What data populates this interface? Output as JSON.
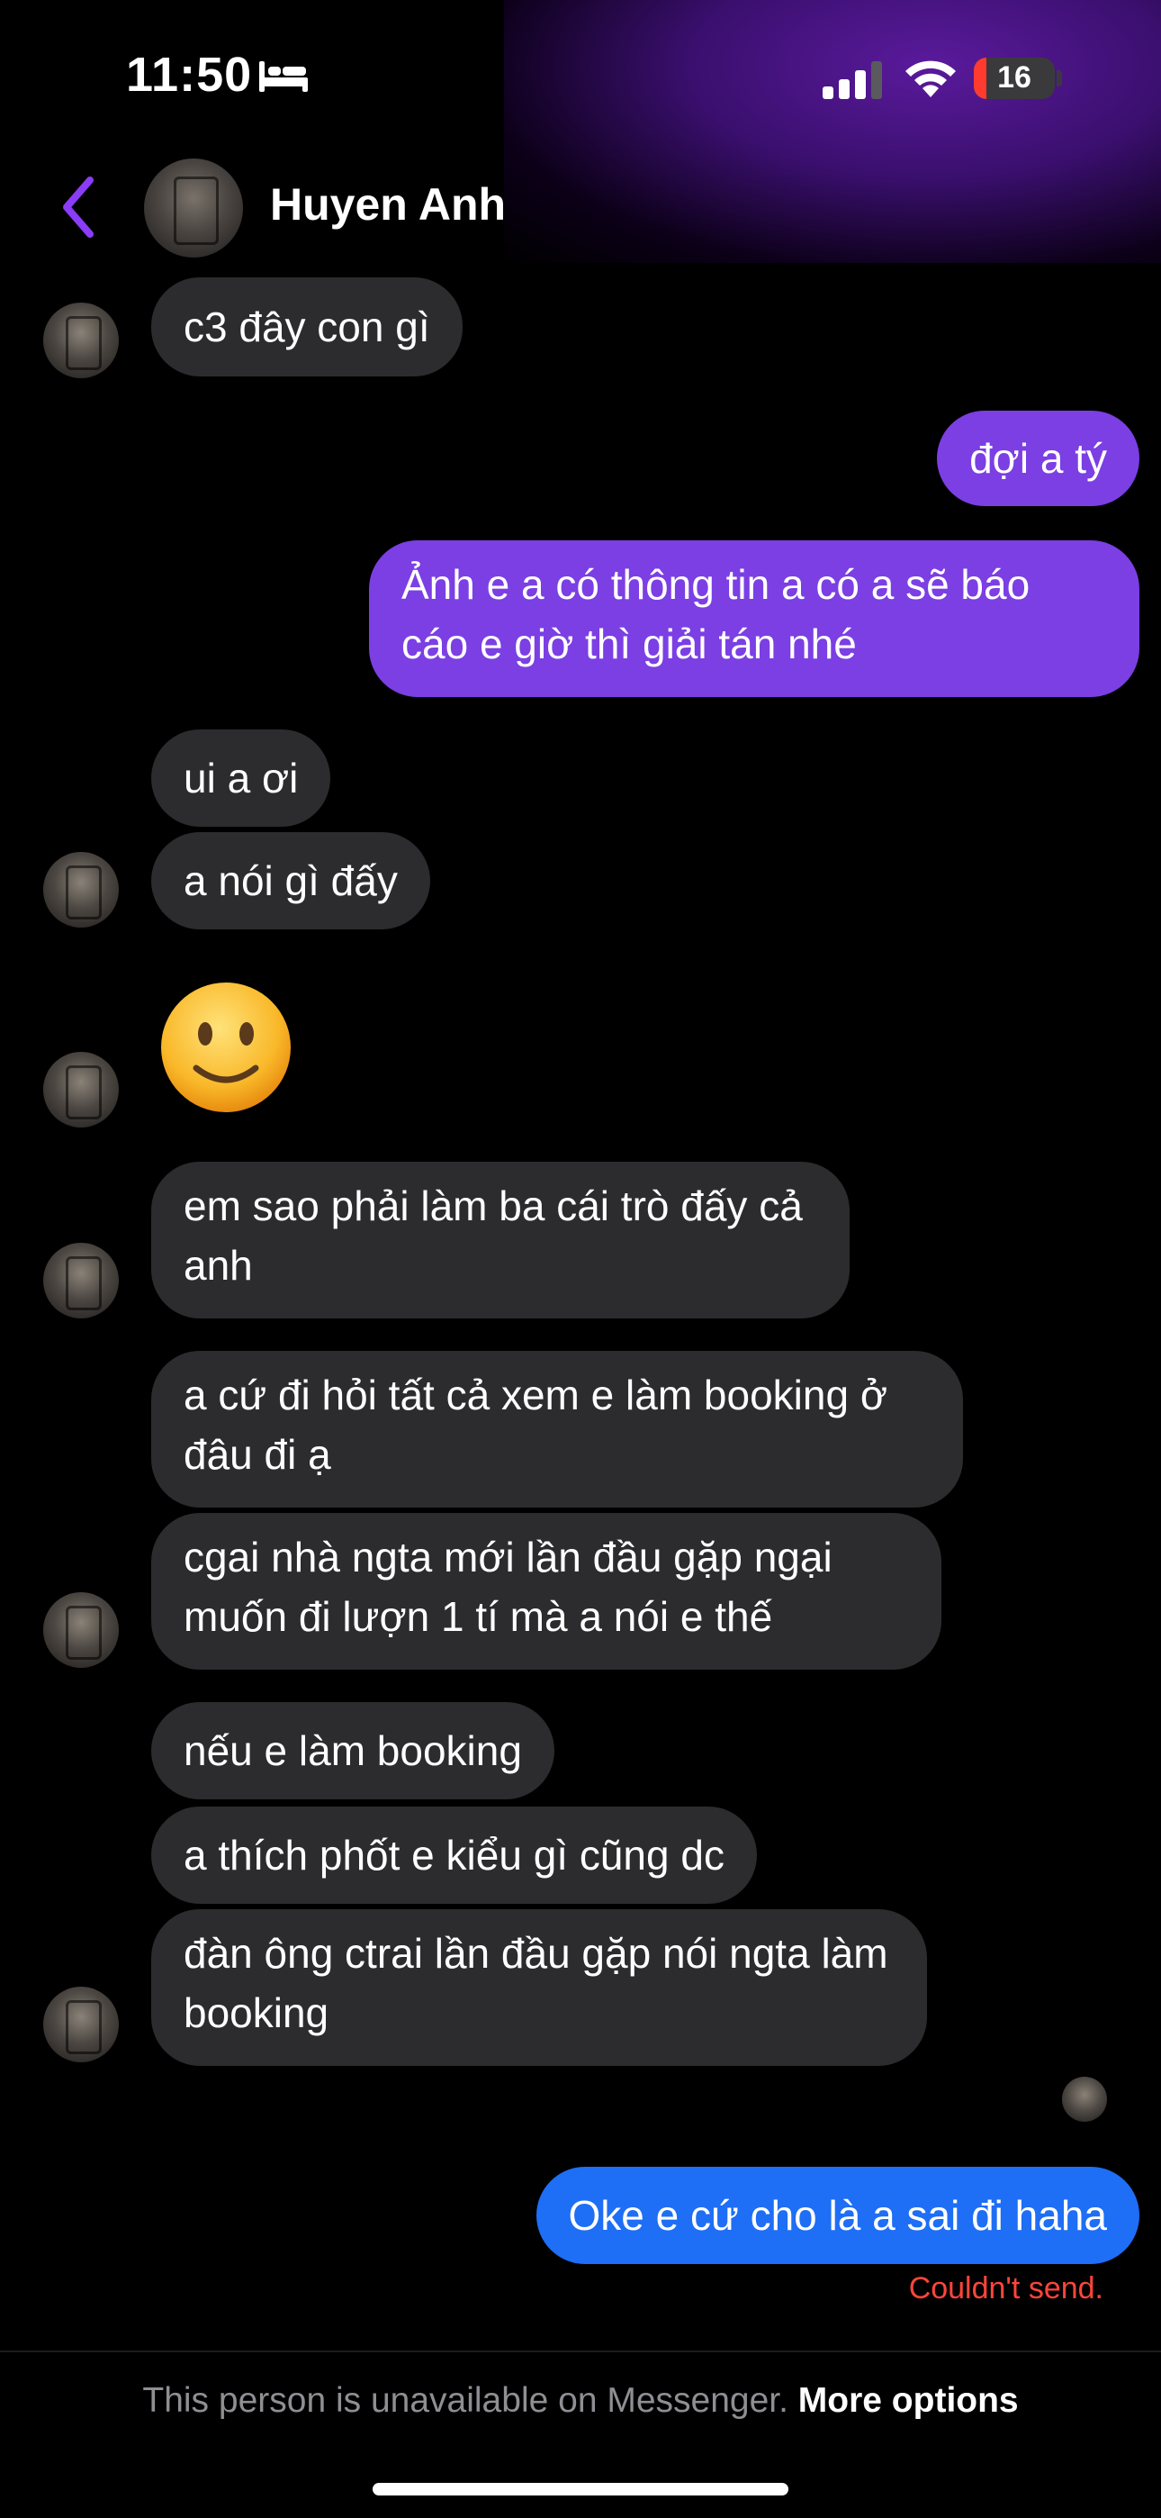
{
  "status_bar": {
    "time": "11:50",
    "battery_level": "16",
    "battery_color": "#ff3b30",
    "icons": [
      "bed-icon",
      "signal-icon",
      "wifi-icon",
      "battery-icon"
    ]
  },
  "header": {
    "contact_name": "Huyen Anh",
    "accent_color": "#8b3cf6"
  },
  "messages": [
    {
      "direction": "in",
      "text": "c3 đây con gì"
    },
    {
      "direction": "out",
      "text": "đợi a tý"
    },
    {
      "direction": "out",
      "text": "Ảnh e a có thông tin a có a sẽ báo cáo e giờ thì giải tán nhé"
    },
    {
      "direction": "in",
      "text": "ui a ơi"
    },
    {
      "direction": "in",
      "text": "a nói gì đấy"
    },
    {
      "direction": "in",
      "text": "🙂",
      "emoji_name": "slightly-smiling-face-icon"
    },
    {
      "direction": "in",
      "text": "em sao phải làm ba cái trò đấy cả anh"
    },
    {
      "direction": "in",
      "text": "a cứ đi hỏi tất cả xem e làm booking ở đâu đi ạ"
    },
    {
      "direction": "in",
      "text": "cgai nhà ngta mới lần đầu gặp ngại muốn đi lượn 1 tí mà a nói e thế"
    },
    {
      "direction": "in",
      "text": "nếu e làm booking"
    },
    {
      "direction": "in",
      "text": "a thích phốt e kiểu gì cũng dc"
    },
    {
      "direction": "in",
      "text": "đàn ông ctrai lần đầu gặp nói ngta làm booking"
    },
    {
      "direction": "out",
      "text": "Oke e cứ cho là a sai đi haha",
      "status": "Couldn't send."
    }
  ],
  "colors": {
    "incoming_bubble": "#2c2c2e",
    "outgoing_bubble": "#7b3fe4",
    "failed_bubble": "#1e6ef6",
    "error_text": "#ff453a"
  },
  "footer": {
    "notice": "This person is unavailable on Messenger.",
    "action": "More options"
  }
}
